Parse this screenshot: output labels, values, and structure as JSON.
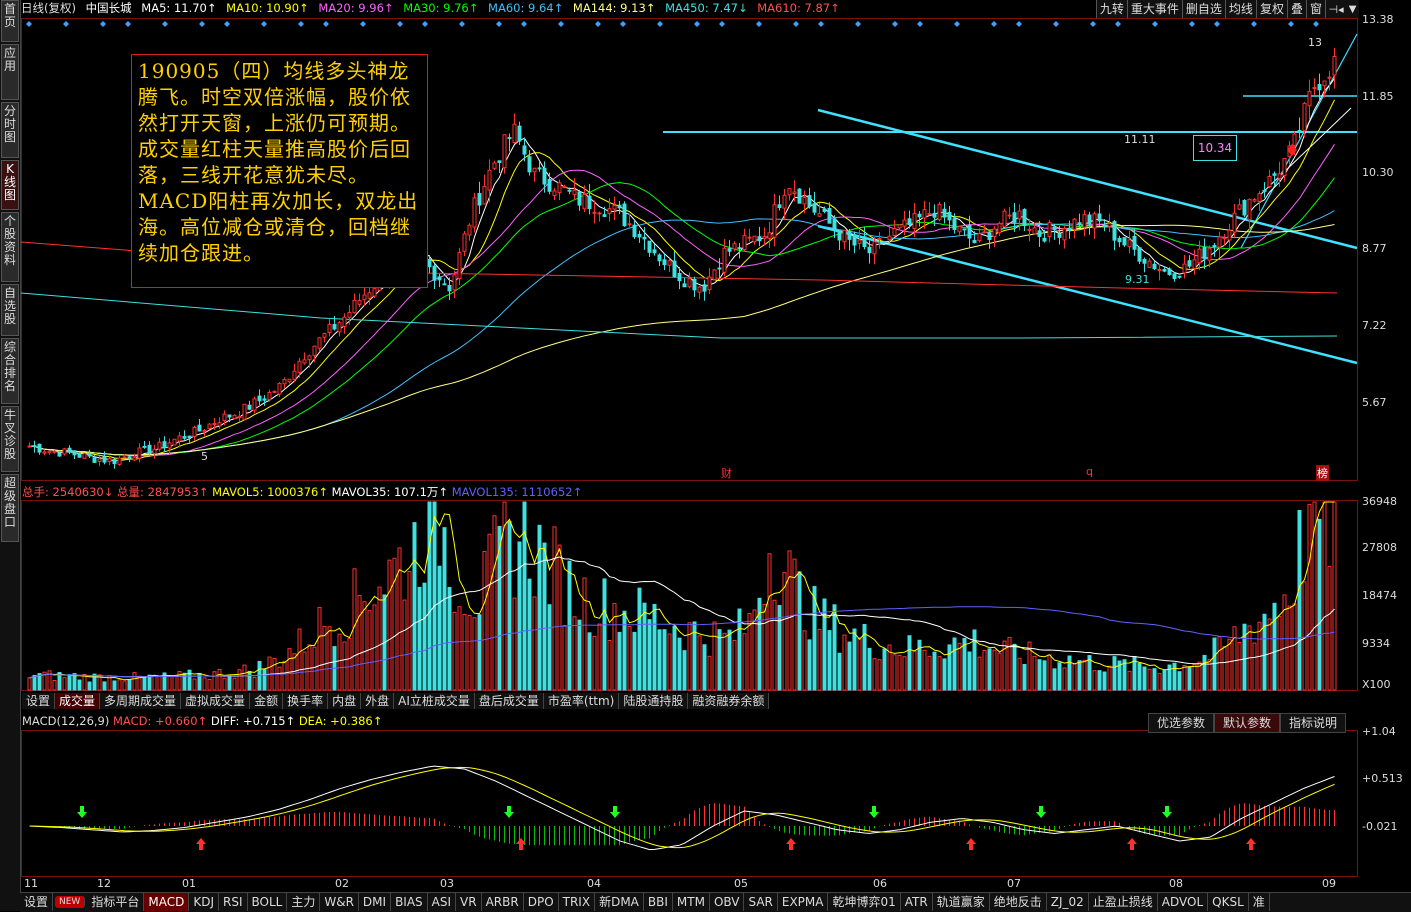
{
  "sidebar": {
    "items": [
      "首页",
      "应用",
      "分时图",
      "K线图",
      "个股资料",
      "自选股",
      "综合排名",
      "牛叉诊股",
      "超级盘口"
    ]
  },
  "header": {
    "period": "日线(复权)",
    "stock": "中国长城",
    "ma5": "MA5: 11.70↑",
    "ma10": "MA10: 10.90↑",
    "ma20": "MA20: 9.96↑",
    "ma30": "MA30: 9.76↑",
    "ma60": "MA60: 9.64↑",
    "ma144": "MA144: 9.13↑",
    "ma450": "MA450: 7.47↓",
    "ma610": "MA610: 7.87↑"
  },
  "toolbar": [
    "九转",
    "重大事件",
    "删自选",
    "均线",
    "复权",
    "叠",
    "窗",
    "预测"
  ],
  "price_axis": [
    "13.38",
    "11.85",
    "10.30",
    "8.77",
    "7.22",
    "5.67"
  ],
  "annotation": "190905（四）均线多头神龙腾飞。时空双倍涨幅，股价依然打开天窗，上涨仍可预期。成交量红柱天量推高股价后回落，三线开花意犹未尽。MACD阳柱再次加长，双龙出海。高位减仓或清仓，回档继续加仓跟进。",
  "chart_labels": {
    "level_1111": "11.11",
    "box_1034": "10.34",
    "level_931": "9.31",
    "high_13": "13",
    "low_5": "5",
    "mark_cai": "财",
    "mark_q": "q",
    "mark_bang": "榜"
  },
  "volume": {
    "header": {
      "zongshou": "总手: 2540630↓",
      "zongliang": "总量: 2847953↑",
      "mavol5": "MAVOL5: 1000376↑",
      "mavol35": "MAVOL35: 107.1万↑",
      "mavol135": "MAVOL135: 1110652↑"
    },
    "axis": [
      "36948",
      "27808",
      "18474",
      "9334",
      "X100"
    ],
    "tabs": [
      "设置",
      "成交量",
      "多周期成交量",
      "虚拟成交量",
      "金额",
      "换手率",
      "内盘",
      "外盘",
      "AI立桩成交量",
      "盘后成交量",
      "市盈率(ttm)",
      "陆股通持股",
      "融资融券余额"
    ]
  },
  "macd": {
    "header": {
      "name": "MACD(12,26,9)",
      "macd": "MACD: +0.660↑",
      "diff": "DIFF: +0.715↑",
      "dea": "DEA: +0.386↑"
    },
    "buttons": [
      "优选参数",
      "默认参数",
      "指标说明"
    ],
    "axis": [
      "+1.04",
      "+0.513",
      "-0.021"
    ]
  },
  "x_axis": [
    "11",
    "12",
    "01",
    "02",
    "03",
    "04",
    "05",
    "06",
    "07",
    "08",
    "09"
  ],
  "bottom_tabs": [
    "设置",
    "NEW",
    "指标平台",
    "MACD",
    "KDJ",
    "RSI",
    "BOLL",
    "主力",
    "W&R",
    "DMI",
    "BIAS",
    "ASI",
    "VR",
    "ARBR",
    "DPO",
    "TRIX",
    "新DMA",
    "BBI",
    "MTM",
    "OBV",
    "SAR",
    "EXPMA",
    "乾坤博弈01",
    "ATR",
    "轨道赢家",
    "绝地反击",
    "ZJ_02",
    "止盈止损线",
    "ADVOL",
    "QKSL",
    "准"
  ],
  "colors": {
    "up": "#ff3030",
    "down": "#40e0e0",
    "ma5": "#ffffff",
    "ma10": "#ffff00",
    "ma20": "#ff60ff",
    "ma30": "#00ff00",
    "ma60": "#40c0ff",
    "ma144": "#ffff80",
    "ma450": "#40e0e0",
    "ma610": "#ff3030",
    "trend": "#40e0ff"
  },
  "chart_data": {
    "type": "candlestick",
    "note_series": "daily OHLC approximated across Oct-2018 to Sep-2019",
    "close_path": [
      5.05,
      4.95,
      4.9,
      4.8,
      4.75,
      4.9,
      5.0,
      5.2,
      5.35,
      5.6,
      5.75,
      6.0,
      6.3,
      6.9,
      7.3,
      7.7,
      8.2,
      8.6,
      9.0,
      8.7,
      8.3,
      9.8,
      10.8,
      11.5,
      10.6,
      10.4,
      10.1,
      10.0,
      9.8,
      9.4,
      8.9,
      8.5,
      8.3,
      9.0,
      9.2,
      9.4,
      10.5,
      10.0,
      9.6,
      9.2,
      9.0,
      9.4,
      9.6,
      9.9,
      9.5,
      9.2,
      9.6,
      9.8,
      9.4,
      9.5,
      9.7,
      9.6,
      9.2,
      8.9,
      8.6,
      8.7,
      9.1,
      9.6,
      10.1,
      10.5,
      11.1,
      12.4,
      12.9
    ],
    "volume_path": [
      30,
      28,
      27,
      25,
      26,
      24,
      25,
      28,
      30,
      35,
      40,
      60,
      90,
      130,
      150,
      200,
      230,
      270,
      369,
      220,
      180,
      280,
      300,
      250,
      200,
      170,
      160,
      150,
      140,
      120,
      110,
      100,
      130,
      300,
      200,
      140,
      120,
      100,
      90,
      80,
      85,
      90,
      95,
      80,
      70,
      65,
      60,
      55,
      50,
      48,
      45,
      50,
      60,
      80,
      120,
      150,
      200,
      360,
      330
    ],
    "macd_path": [
      0.0,
      -0.02,
      -0.05,
      -0.08,
      -0.06,
      -0.02,
      0.05,
      0.12,
      0.22,
      0.35,
      0.5,
      0.62,
      0.72,
      0.8,
      0.76,
      0.6,
      0.4,
      0.2,
      0.0,
      -0.2,
      -0.32,
      -0.25,
      0.0,
      0.2,
      0.15,
      0.05,
      -0.05,
      -0.1,
      -0.05,
      0.05,
      0.1,
      0.05,
      -0.05,
      -0.1,
      -0.05,
      0.0,
      -0.1,
      -0.2,
      -0.15,
      0.1,
      0.3,
      0.5,
      0.66
    ],
    "ylim": [
      4.6,
      13.6
    ]
  }
}
